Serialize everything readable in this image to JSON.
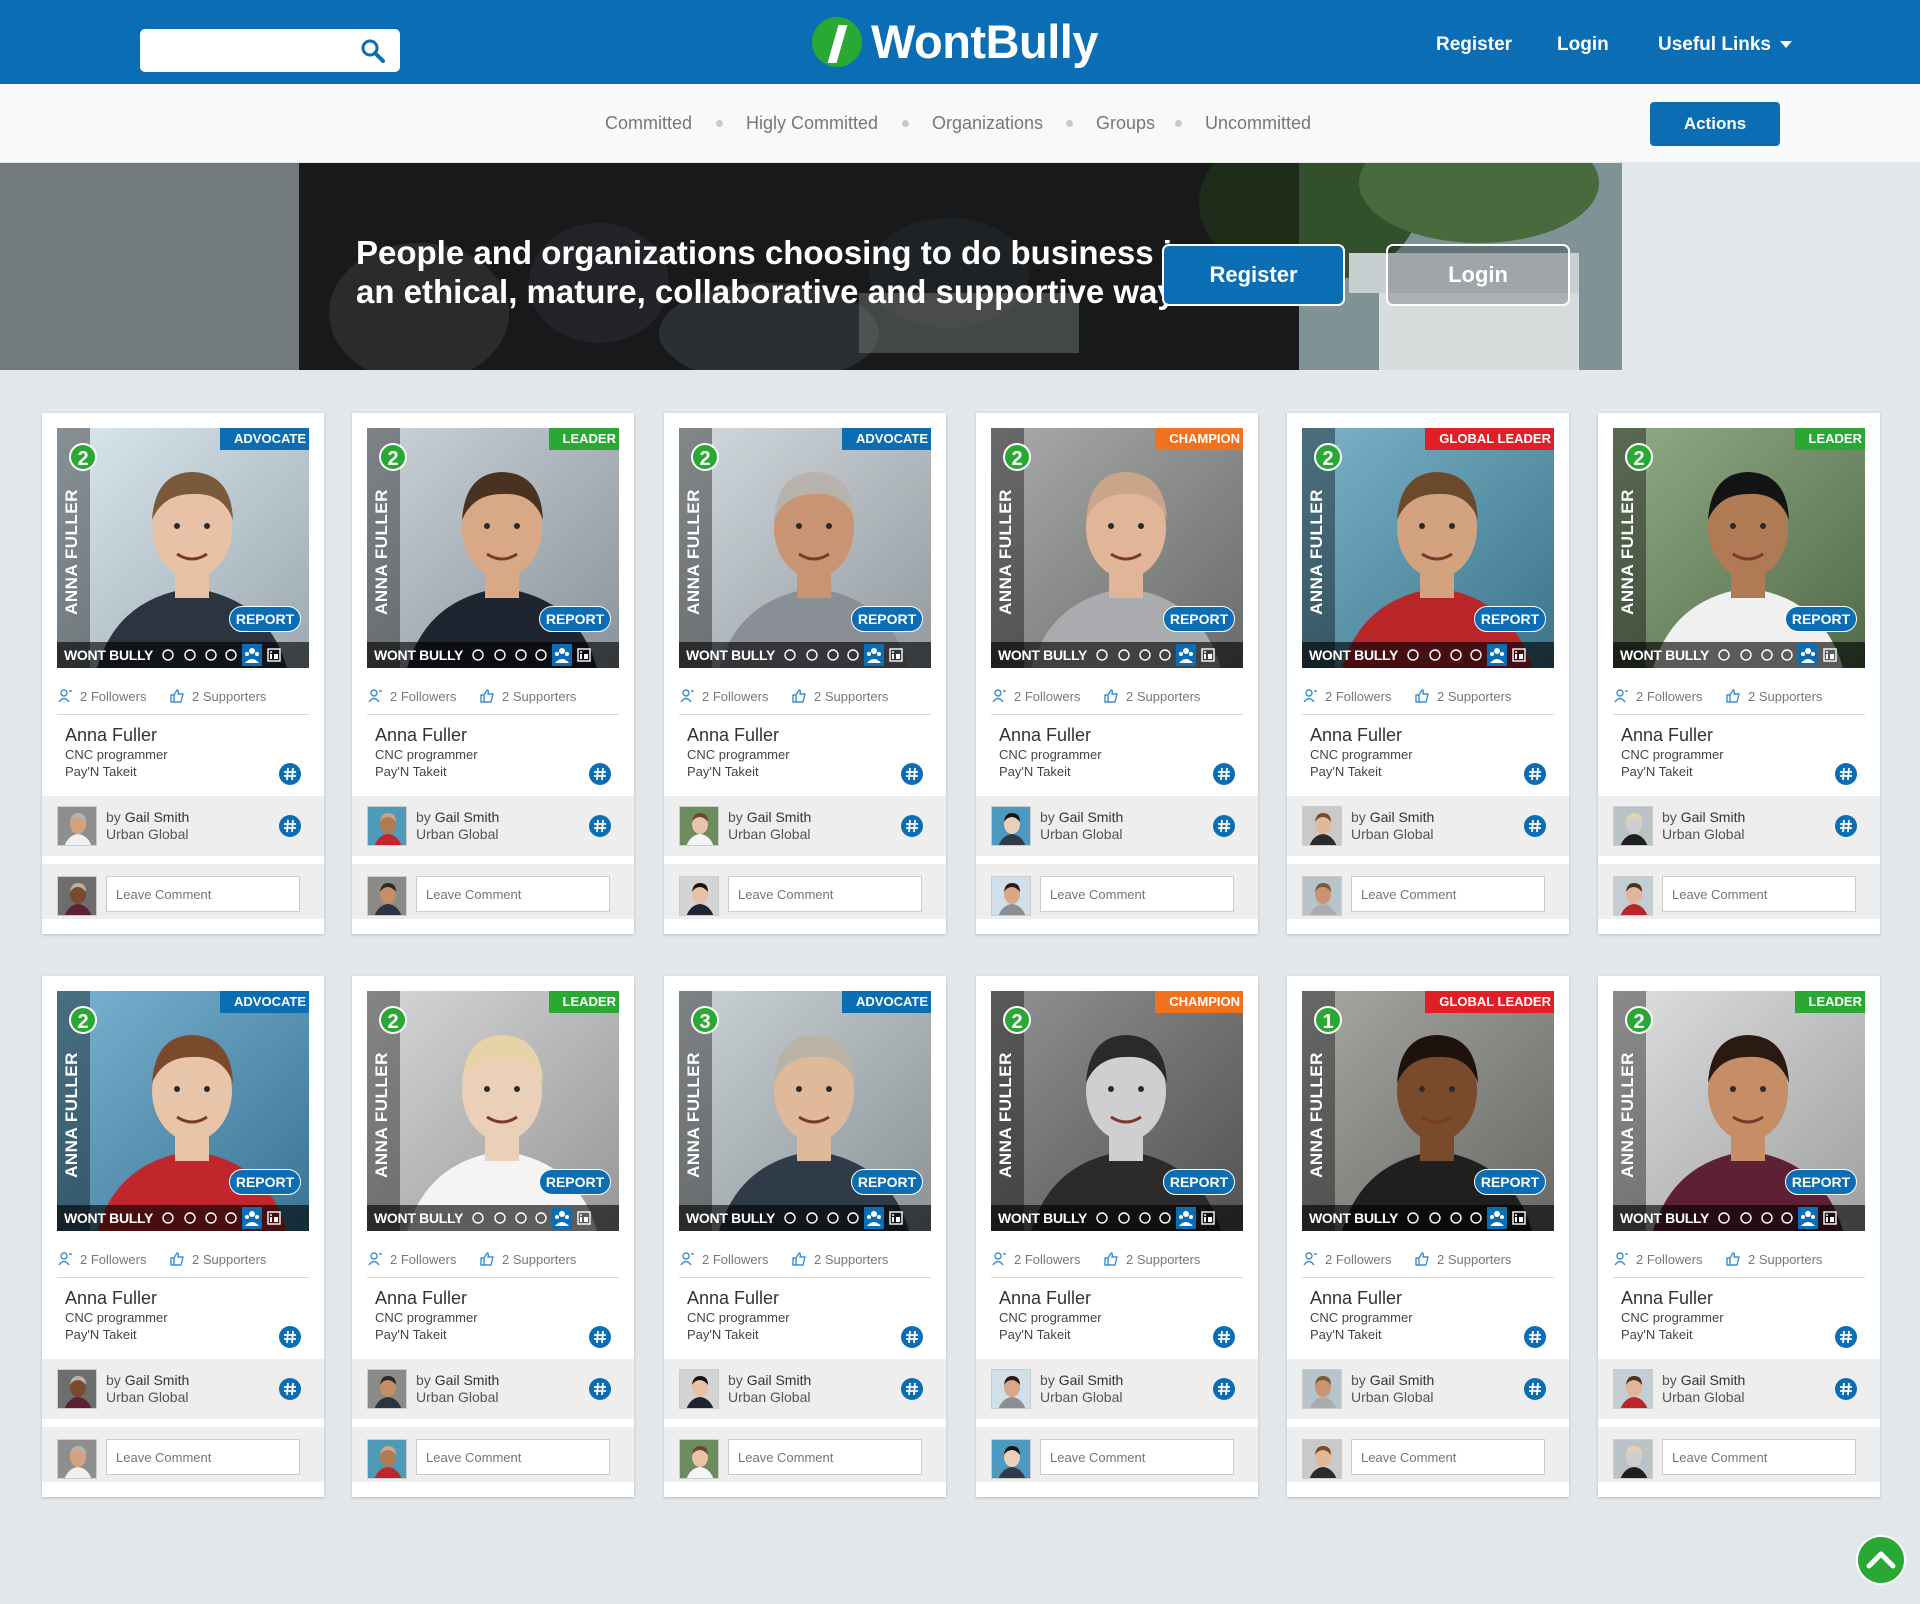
{
  "header": {
    "search_placeholder": "",
    "logo_text": "WontBully",
    "nav": [
      {
        "label": "Register"
      },
      {
        "label": "Login"
      },
      {
        "label": "Useful Links"
      }
    ]
  },
  "subnav": {
    "items": [
      {
        "label": "Committed"
      },
      {
        "label": "Higly Committed"
      },
      {
        "label": "Organizations"
      },
      {
        "label": "Groups"
      },
      {
        "label": "Uncommitted"
      }
    ],
    "actions_label": "Actions"
  },
  "hero": {
    "text": "People and organizations choosing to do business in an ethical, mature, collaborative and supportive way.",
    "register_label": "Register",
    "login_label": "Login"
  },
  "colors": {
    "primary": "#0b6db4",
    "green": "#2aa834",
    "advocate": "#0b6db4",
    "leader": "#2aa834",
    "champion": "#f2711c",
    "global_leader": "#e21e26"
  },
  "card_common": {
    "vertical_name": "ANNA FULLER",
    "bar_brand": "WONT BULLY",
    "report_label": "REPORT",
    "followers": "2 Followers",
    "supporters": "2 Supporters",
    "name": "Anna Fuller",
    "role": "CNC programmer",
    "company": "Pay'N Takeit",
    "by_prefix": "by",
    "by_name": "Gail Smith",
    "by_company": "Urban Global",
    "comment_placeholder": "Leave Comment"
  },
  "cards": [
    {
      "rank": "2",
      "badge": "ADVOCATE",
      "badge_color": "#0b6db4"
    },
    {
      "rank": "2",
      "badge": "LEADER",
      "badge_color": "#2aa834"
    },
    {
      "rank": "2",
      "badge": "ADVOCATE",
      "badge_color": "#0b6db4"
    },
    {
      "rank": "2",
      "badge": "CHAMPION",
      "badge_color": "#f2711c"
    },
    {
      "rank": "2",
      "badge": "GLOBAL LEADER",
      "badge_color": "#e21e26"
    },
    {
      "rank": "2",
      "badge": "LEADER",
      "badge_color": "#2aa834"
    },
    {
      "rank": "2",
      "badge": "ADVOCATE",
      "badge_color": "#0b6db4"
    },
    {
      "rank": "2",
      "badge": "LEADER",
      "badge_color": "#2aa834"
    },
    {
      "rank": "3",
      "badge": "ADVOCATE",
      "badge_color": "#0b6db4"
    },
    {
      "rank": "2",
      "badge": "CHAMPION",
      "badge_color": "#f2711c"
    },
    {
      "rank": "1",
      "badge": "GLOBAL LEADER",
      "badge_color": "#e21e26"
    },
    {
      "rank": "2",
      "badge": "LEADER",
      "badge_color": "#2aa834"
    }
  ]
}
